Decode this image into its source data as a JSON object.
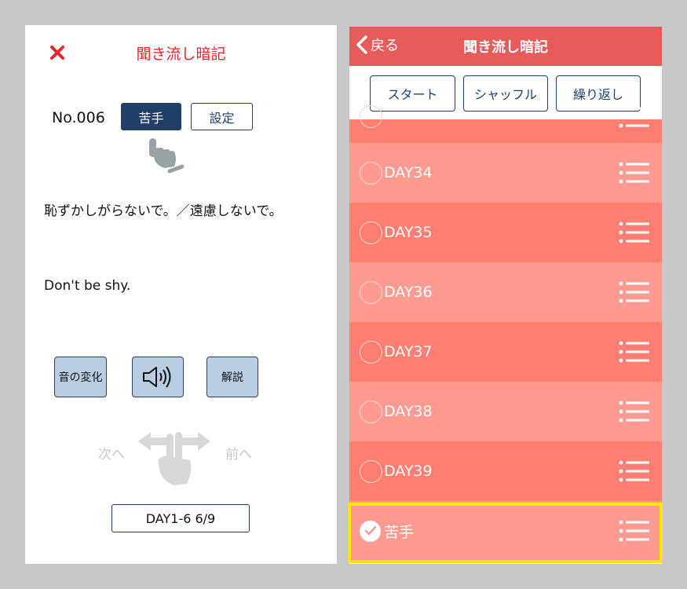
{
  "left": {
    "title": "聞き流し暗記",
    "item_no": "No.006",
    "weak_button": "苦手",
    "settings_button": "設定",
    "japanese_text": "恥ずかしがらないで。／遠慮しないで。",
    "english_text": "Don't be shy.",
    "sound_change_button": "音の変化",
    "explanation_button": "解説",
    "swipe_next": "次へ",
    "swipe_prev": "前へ",
    "progress": "DAY1-6 6/9"
  },
  "right": {
    "back_label": "戻る",
    "title": "聞き流し暗記",
    "toolbar": {
      "start": "スタート",
      "shuffle": "シャッフル",
      "repeat": "繰り返し"
    },
    "rows": [
      {
        "label": "DAY34"
      },
      {
        "label": "DAY35"
      },
      {
        "label": "DAY36"
      },
      {
        "label": "DAY37"
      },
      {
        "label": "DAY38"
      },
      {
        "label": "DAY39"
      },
      {
        "label": "苦手"
      }
    ]
  },
  "colors": {
    "accent_red": "#e8262b",
    "header_red": "#e85b5b",
    "row_dark": "#ff7e72",
    "row_light": "#ff9a90",
    "navy": "#1f3f66",
    "highlight": "#ffe600"
  }
}
